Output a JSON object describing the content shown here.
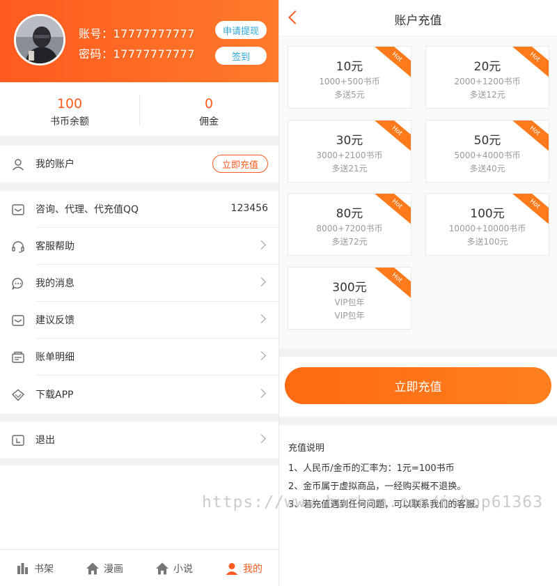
{
  "profile": {
    "account_line": "账号：17777777777",
    "password_line": "密码：17777777777",
    "withdraw_btn": "申请提现",
    "checkin_btn": "签到"
  },
  "stats": {
    "coins_value": "100",
    "coins_label": "书币余额",
    "commission_value": "0",
    "commission_label": "佣金"
  },
  "menu": {
    "my_account": "我的账户",
    "recharge_now": "立即充值",
    "consult": "咨询、代理、代充值QQ",
    "qq_number": "123456",
    "support": "客服帮助",
    "messages": "我的消息",
    "feedback": "建议反馈",
    "bills": "账单明细",
    "download": "下载APP",
    "logout": "退出"
  },
  "tabs": {
    "shelf": "书架",
    "comics": "漫画",
    "novels": "小说",
    "mine": "我的"
  },
  "recharge": {
    "title": "账户充值",
    "hot": "Hot",
    "packages": [
      {
        "price": "10元",
        "detail": "1000+500书币",
        "bonus": "多送5元"
      },
      {
        "price": "20元",
        "detail": "2000+1200书币",
        "bonus": "多送12元"
      },
      {
        "price": "30元",
        "detail": "3000+2100书币",
        "bonus": "多送21元"
      },
      {
        "price": "50元",
        "detail": "5000+4000书币",
        "bonus": "多送40元"
      },
      {
        "price": "80元",
        "detail": "8000+7200书币",
        "bonus": "多送72元"
      },
      {
        "price": "100元",
        "detail": "10000+10000书币",
        "bonus": "多送100元"
      },
      {
        "price": "300元",
        "detail": "VIP包年",
        "bonus": "VIP包年"
      }
    ],
    "button": "立即充值",
    "notes_title": "充值说明",
    "notes": [
      "1、人民币/金币的汇率为：1元=100书币",
      "2、金币属于虚拟商品，一经购买概不退换。",
      "3、若充值遇到任何问题，可以联系我们的客服。"
    ]
  },
  "watermark": "https://www.huzhan.com/ishop61363",
  "colors": {
    "accent": "#ff5a1f",
    "button_orange": "#ff7a1a",
    "link_blue": "#2aa5d8"
  }
}
